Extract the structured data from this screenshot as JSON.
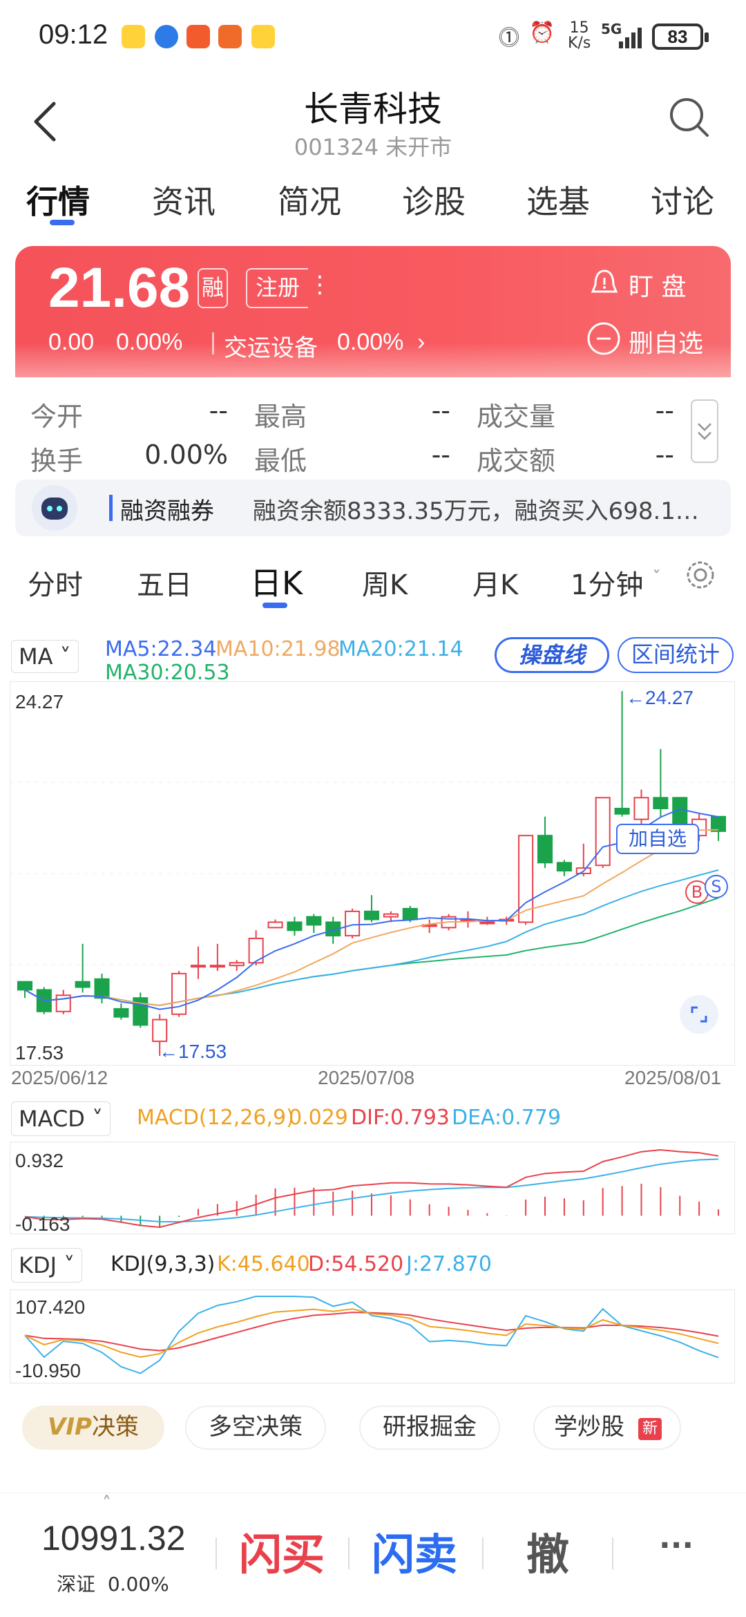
{
  "status_bar": {
    "time": "09:12",
    "net_speed_value": "15",
    "net_speed_unit": "K/s",
    "network": "5G",
    "battery": "83",
    "app_icons": [
      "duck-app-icon",
      "blue-circle-app-icon",
      "paper-plane-app-icon",
      "red-app-icon",
      "duck-app-icon-2"
    ]
  },
  "header": {
    "title": "长青科技",
    "subtitle": "001324 未开市"
  },
  "tabs": [
    "行情",
    "资讯",
    "简况",
    "诊股",
    "选基",
    "讨论"
  ],
  "quote": {
    "price": "21.68",
    "tag_margin": "融",
    "tag_register": "注册",
    "change": "0.00",
    "change_pct": "0.00%",
    "sector": "交运设备",
    "sector_pct": "0.00%",
    "watch_label": "盯 盘",
    "remove_label": "删自选"
  },
  "stats": [
    {
      "label": "今开",
      "value": "--"
    },
    {
      "label": "最高",
      "value": "--"
    },
    {
      "label": "成交量",
      "value": "--"
    },
    {
      "label": "换手",
      "value": "0.00%"
    },
    {
      "label": "最低",
      "value": "--"
    },
    {
      "label": "成交额",
      "value": "--"
    }
  ],
  "notice": {
    "title": "融资融券",
    "text": "融资余额8333.35万元，融资买入698.1…"
  },
  "kline_tabs": [
    "分时",
    "五日",
    "日K",
    "周K",
    "月K",
    "1分钟"
  ],
  "ma_legend": {
    "selector": "MA",
    "ma5": "MA5:22.34",
    "ma10": "MA10:21.98",
    "ma20": "MA20:21.14",
    "ma30": "MA30:20.53",
    "btn_operate": "操盘线",
    "btn_range": "区间统计"
  },
  "chart_labels": {
    "y_top": "24.27",
    "y_bottom": "17.53",
    "high_marker": "←24.27",
    "low_marker": "←17.53",
    "add_watch": "加自选",
    "buy_marker": "B",
    "sell_marker": "S",
    "x_dates": [
      "2025/06/12",
      "2025/07/08",
      "2025/08/01"
    ]
  },
  "macd": {
    "selector": "MACD",
    "params": "MACD(12,26,9)",
    "macd_val": "0.029",
    "dif": "DIF:0.793",
    "dea": "DEA:0.779",
    "y_top": "0.932",
    "y_bottom": "-0.163"
  },
  "kdj": {
    "selector": "KDJ",
    "params": "KDJ(9,3,3)",
    "k": "K:45.640",
    "d": "D:54.520",
    "j": "J:27.870",
    "y_top": "107.420",
    "y_bottom": "-10.950"
  },
  "bottom_tabs": {
    "vip": "VIP",
    "vip_suffix": "决策",
    "long_short": "多空决策",
    "research": "研报掘金",
    "learn": "学炒股",
    "new_badge": "新"
  },
  "bottom_bar": {
    "index_value": "10991.32",
    "index_name": "深证",
    "index_pct": "0.00%",
    "buy": "闪买",
    "sell": "闪卖",
    "cancel": "撤",
    "more": "···"
  },
  "colors": {
    "up": "#e8414c",
    "down": "#1aa34a",
    "accent": "#3a6cf0",
    "ma5": "#3a6cf0",
    "ma10": "#f0a860",
    "ma20": "#3bb0e8",
    "ma30": "#21b36b"
  },
  "chart_data": {
    "type": "candlestick",
    "x_range": [
      "2025/06/12",
      "2025/08/01"
    ],
    "ylim": [
      17.53,
      24.27
    ],
    "candles": [
      {
        "o": 18.9,
        "c": 18.75,
        "h": 18.9,
        "l": 18.6
      },
      {
        "o": 18.75,
        "c": 18.35,
        "h": 18.8,
        "l": 18.3
      },
      {
        "o": 18.35,
        "c": 18.65,
        "h": 18.75,
        "l": 18.3
      },
      {
        "o": 18.9,
        "c": 18.8,
        "h": 19.6,
        "l": 18.7
      },
      {
        "o": 18.95,
        "c": 18.6,
        "h": 19.05,
        "l": 18.5
      },
      {
        "o": 18.4,
        "c": 18.25,
        "h": 18.5,
        "l": 18.2
      },
      {
        "o": 18.6,
        "c": 18.1,
        "h": 18.7,
        "l": 18.05
      },
      {
        "o": 17.8,
        "c": 18.2,
        "h": 18.3,
        "l": 17.53
      },
      {
        "o": 18.3,
        "c": 19.05,
        "h": 19.1,
        "l": 18.25
      },
      {
        "o": 19.2,
        "c": 19.2,
        "h": 19.55,
        "l": 18.95
      },
      {
        "o": 19.2,
        "c": 19.2,
        "h": 19.6,
        "l": 19.1
      },
      {
        "o": 19.2,
        "c": 19.25,
        "h": 19.3,
        "l": 19.1
      },
      {
        "o": 19.25,
        "c": 19.7,
        "h": 19.85,
        "l": 19.2
      },
      {
        "o": 19.9,
        "c": 20.0,
        "h": 20.05,
        "l": 19.9
      },
      {
        "o": 20.0,
        "c": 19.85,
        "h": 20.1,
        "l": 19.75
      },
      {
        "o": 20.1,
        "c": 19.95,
        "h": 20.15,
        "l": 19.8
      },
      {
        "o": 20.0,
        "c": 19.75,
        "h": 20.1,
        "l": 19.6
      },
      {
        "o": 19.75,
        "c": 20.2,
        "h": 20.25,
        "l": 19.7
      },
      {
        "o": 20.2,
        "c": 20.05,
        "h": 20.5,
        "l": 20.0
      },
      {
        "o": 20.1,
        "c": 20.15,
        "h": 20.2,
        "l": 20.0
      },
      {
        "o": 20.25,
        "c": 20.05,
        "h": 20.3,
        "l": 20.0
      },
      {
        "o": 19.95,
        "c": 19.95,
        "h": 20.05,
        "l": 19.8
      },
      {
        "o": 19.9,
        "c": 20.1,
        "h": 20.15,
        "l": 19.85
      },
      {
        "o": 20.05,
        "c": 20.05,
        "h": 20.2,
        "l": 19.9
      },
      {
        "o": 20.0,
        "c": 20.0,
        "h": 20.1,
        "l": 19.95
      },
      {
        "o": 20.05,
        "c": 20.05,
        "h": 20.1,
        "l": 19.95
      },
      {
        "o": 20.0,
        "c": 21.6,
        "h": 21.6,
        "l": 19.95
      },
      {
        "o": 21.6,
        "c": 21.1,
        "h": 21.95,
        "l": 21.0
      },
      {
        "o": 21.1,
        "c": 20.95,
        "h": 21.15,
        "l": 20.85
      },
      {
        "o": 20.9,
        "c": 21.0,
        "h": 21.45,
        "l": 20.85
      },
      {
        "o": 21.05,
        "c": 22.3,
        "h": 22.3,
        "l": 21.0
      },
      {
        "o": 22.1,
        "c": 22.0,
        "h": 24.27,
        "l": 21.95
      },
      {
        "o": 21.9,
        "c": 22.3,
        "h": 22.45,
        "l": 21.75
      },
      {
        "o": 22.3,
        "c": 22.1,
        "h": 23.2,
        "l": 21.95
      },
      {
        "o": 22.3,
        "c": 21.75,
        "h": 22.3,
        "l": 21.65
      },
      {
        "o": 21.6,
        "c": 21.9,
        "h": 22.0,
        "l": 21.5
      },
      {
        "o": 21.95,
        "c": 21.68,
        "h": 21.95,
        "l": 21.5
      }
    ],
    "macd_range": [
      -0.163,
      0.932
    ],
    "kdj_range": [
      -10.95,
      107.42
    ]
  }
}
